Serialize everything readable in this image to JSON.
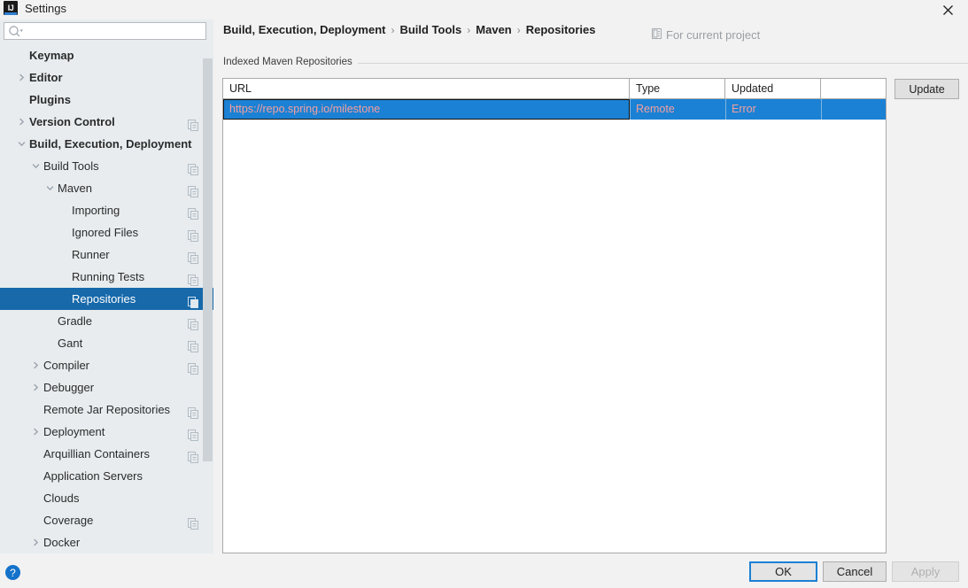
{
  "window": {
    "title": "Settings",
    "app_icon": "intellij-idea-icon",
    "close_label": "✕"
  },
  "sidebar": {
    "search": {
      "placeholder": "",
      "value": "",
      "icon": "search-icon"
    },
    "items": [
      {
        "label": "Keymap",
        "indent": 33,
        "bold": true,
        "arrow": "none",
        "copy": false,
        "selected": false
      },
      {
        "label": "Editor",
        "indent": 33,
        "bold": true,
        "arrow": "right",
        "copy": false,
        "selected": false
      },
      {
        "label": "Plugins",
        "indent": 33,
        "bold": true,
        "arrow": "none",
        "copy": false,
        "selected": false
      },
      {
        "label": "Version Control",
        "indent": 33,
        "bold": true,
        "arrow": "right",
        "copy": true,
        "selected": false
      },
      {
        "label": "Build, Execution, Deployment",
        "indent": 33,
        "bold": true,
        "arrow": "down",
        "copy": false,
        "selected": false
      },
      {
        "label": "Build Tools",
        "indent": 49,
        "bold": false,
        "arrow": "down",
        "copy": true,
        "selected": false
      },
      {
        "label": "Maven",
        "indent": 65,
        "bold": false,
        "arrow": "down",
        "copy": true,
        "selected": false
      },
      {
        "label": "Importing",
        "indent": 81,
        "bold": false,
        "arrow": "none",
        "copy": true,
        "selected": false
      },
      {
        "label": "Ignored Files",
        "indent": 81,
        "bold": false,
        "arrow": "none",
        "copy": true,
        "selected": false
      },
      {
        "label": "Runner",
        "indent": 81,
        "bold": false,
        "arrow": "none",
        "copy": true,
        "selected": false
      },
      {
        "label": "Running Tests",
        "indent": 81,
        "bold": false,
        "arrow": "none",
        "copy": true,
        "selected": false
      },
      {
        "label": "Repositories",
        "indent": 81,
        "bold": false,
        "arrow": "none",
        "copy": true,
        "selected": true
      },
      {
        "label": "Gradle",
        "indent": 65,
        "bold": false,
        "arrow": "none",
        "copy": true,
        "selected": false
      },
      {
        "label": "Gant",
        "indent": 65,
        "bold": false,
        "arrow": "none",
        "copy": true,
        "selected": false
      },
      {
        "label": "Compiler",
        "indent": 49,
        "bold": false,
        "arrow": "right",
        "copy": true,
        "selected": false
      },
      {
        "label": "Debugger",
        "indent": 49,
        "bold": false,
        "arrow": "right",
        "copy": false,
        "selected": false
      },
      {
        "label": "Remote Jar Repositories",
        "indent": 49,
        "bold": false,
        "arrow": "none",
        "copy": true,
        "selected": false
      },
      {
        "label": "Deployment",
        "indent": 49,
        "bold": false,
        "arrow": "right",
        "copy": true,
        "selected": false
      },
      {
        "label": "Arquillian Containers",
        "indent": 49,
        "bold": false,
        "arrow": "none",
        "copy": true,
        "selected": false
      },
      {
        "label": "Application Servers",
        "indent": 49,
        "bold": false,
        "arrow": "none",
        "copy": false,
        "selected": false
      },
      {
        "label": "Clouds",
        "indent": 49,
        "bold": false,
        "arrow": "none",
        "copy": false,
        "selected": false
      },
      {
        "label": "Coverage",
        "indent": 49,
        "bold": false,
        "arrow": "none",
        "copy": true,
        "selected": false
      },
      {
        "label": "Docker",
        "indent": 49,
        "bold": false,
        "arrow": "right",
        "copy": false,
        "selected": false
      }
    ]
  },
  "main": {
    "breadcrumb": [
      "Build, Execution, Deployment",
      "Build Tools",
      "Maven",
      "Repositories"
    ],
    "breadcrumb_separator": "›",
    "scope_label": "For current project",
    "scope_icon": "project-scope-icon",
    "group_label": "Indexed Maven Repositories",
    "update_button": "Update",
    "table": {
      "columns": [
        "URL",
        "Type",
        "Updated",
        ""
      ],
      "rows": [
        {
          "url": "https://repo.spring.io/milestone",
          "type": "Remote",
          "updated": "Error",
          "extra": "",
          "selected": true
        }
      ]
    }
  },
  "footer": {
    "help_label": "?",
    "ok_label": "OK",
    "cancel_label": "Cancel",
    "apply_label": "Apply"
  },
  "colors": {
    "selection_blue": "#1769aa",
    "row_blue": "#1b81d4",
    "error_text": "#f2a0a0",
    "accent": "#1472ca",
    "window_bg": "#f2f2f2",
    "sidebar_bg": "#e8ecef"
  }
}
